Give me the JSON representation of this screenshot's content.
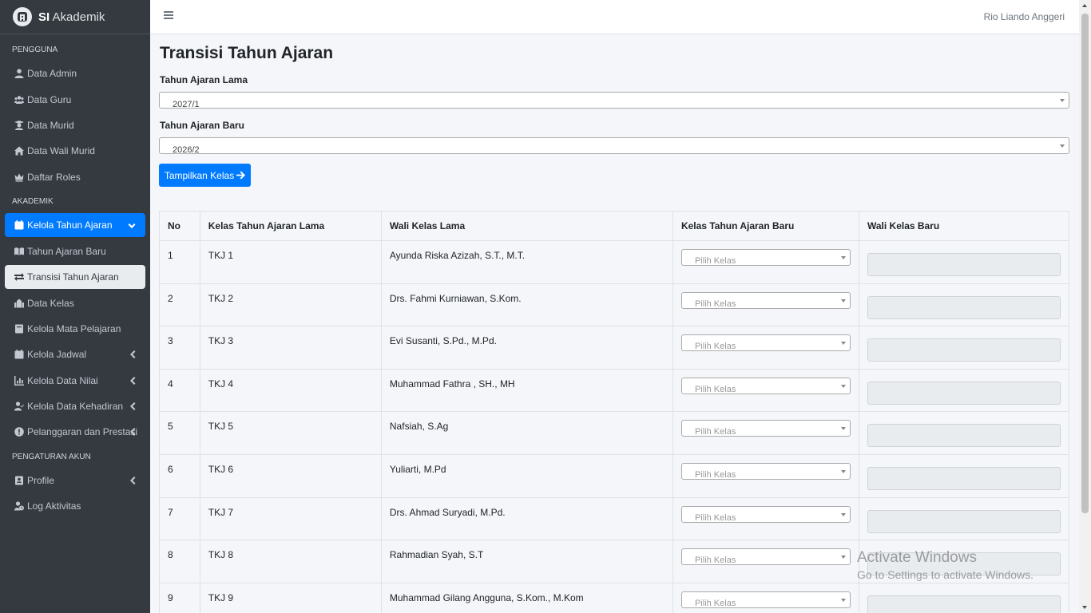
{
  "brand": {
    "bold": "SI",
    "rest": "Akademik"
  },
  "topbar": {
    "username": "Rio Liando Anggeri"
  },
  "sidebar": {
    "headers": [
      "PENGGUNA",
      "AKADEMIK",
      "PENGATURAN AKUN"
    ],
    "items": [
      {
        "label": "Data Admin",
        "icon": "user-icon"
      },
      {
        "label": "Data Guru",
        "icon": "users-icon"
      },
      {
        "label": "Data Murid",
        "icon": "graduation-icon"
      },
      {
        "label": "Data Wali Murid",
        "icon": "home-icon"
      },
      {
        "label": "Daftar Roles",
        "icon": "crown-icon"
      },
      {
        "label": "Kelola Tahun Ajaran",
        "icon": "calendar-icon"
      },
      {
        "label": "Tahun Ajaran Baru",
        "icon": "book-icon"
      },
      {
        "label": "Transisi Tahun Ajaran",
        "icon": "exchange-icon"
      },
      {
        "label": "Data Kelas",
        "icon": "school-icon"
      },
      {
        "label": "Kelola Mata Pelajaran",
        "icon": "book-closed-icon"
      },
      {
        "label": "Kelola Jadwal",
        "icon": "calendar-check-icon"
      },
      {
        "label": "Kelola Data Nilai",
        "icon": "chart-icon"
      },
      {
        "label": "Kelola Data Kehadiran",
        "icon": "user-check-icon"
      },
      {
        "label": "Pelanggaran dan Prestasi",
        "icon": "exclamation-icon"
      },
      {
        "label": "Profile",
        "icon": "id-card-icon"
      },
      {
        "label": "Log Aktivitas",
        "icon": "user-clock-icon"
      }
    ]
  },
  "main": {
    "title": "Transisi Tahun Ajaran",
    "old_year_label": "Tahun Ajaran Lama",
    "old_year_value": "2027/1",
    "new_year_label": "Tahun Ajaran Baru",
    "new_year_value": "2026/2",
    "show_button": "Tampilkan Kelas"
  },
  "table": {
    "headers": [
      "No",
      "Kelas Tahun Ajaran Lama",
      "Wali Kelas Lama",
      "Kelas Tahun Ajaran Baru",
      "Wali Kelas Baru"
    ],
    "select_placeholder": "Pilih Kelas",
    "rows": [
      {
        "no": "1",
        "kelas": "TKJ 1",
        "wali": "Ayunda Riska Azizah, S.T., M.T."
      },
      {
        "no": "2",
        "kelas": "TKJ 2",
        "wali": "Drs. Fahmi Kurniawan, S.Kom."
      },
      {
        "no": "3",
        "kelas": "TKJ 3",
        "wali": "Evi Susanti, S.Pd., M.Pd."
      },
      {
        "no": "4",
        "kelas": "TKJ 4",
        "wali": "Muhammad Fathra , SH., MH"
      },
      {
        "no": "5",
        "kelas": "TKJ 5",
        "wali": "Nafsiah, S.Ag"
      },
      {
        "no": "6",
        "kelas": "TKJ 6",
        "wali": "Yuliarti, M.Pd"
      },
      {
        "no": "7",
        "kelas": "TKJ 7",
        "wali": "Drs. Ahmad Suryadi, M.Pd."
      },
      {
        "no": "8",
        "kelas": "TKJ 8",
        "wali": "Rahmadian Syah, S.T"
      },
      {
        "no": "9",
        "kelas": "TKJ 9",
        "wali": "Muhammad Gilang Angguna, S.Kom., M.Kom"
      }
    ]
  },
  "watermark": {
    "line1": "Activate Windows",
    "line2": "Go to Settings to activate Windows."
  }
}
